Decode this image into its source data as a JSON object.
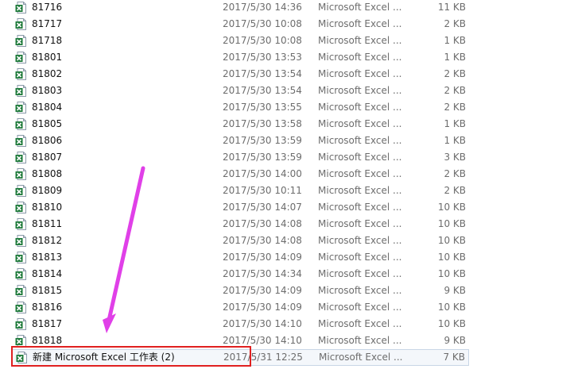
{
  "icon": "excel-file-icon",
  "colors": {
    "annotation_arrow": "#e040e8",
    "highlight_box": "#e02020",
    "excel_green": "#1d7a3a"
  },
  "files": [
    {
      "name": "81716",
      "date": "2017/5/30 14:36",
      "type": "Microsoft Excel ...",
      "size": "11 KB"
    },
    {
      "name": "81717",
      "date": "2017/5/30 10:08",
      "type": "Microsoft Excel ...",
      "size": "2 KB"
    },
    {
      "name": "81718",
      "date": "2017/5/30 10:08",
      "type": "Microsoft Excel ...",
      "size": "1 KB"
    },
    {
      "name": "81801",
      "date": "2017/5/30 13:53",
      "type": "Microsoft Excel ...",
      "size": "1 KB"
    },
    {
      "name": "81802",
      "date": "2017/5/30 13:54",
      "type": "Microsoft Excel ...",
      "size": "2 KB"
    },
    {
      "name": "81803",
      "date": "2017/5/30 13:54",
      "type": "Microsoft Excel ...",
      "size": "2 KB"
    },
    {
      "name": "81804",
      "date": "2017/5/30 13:55",
      "type": "Microsoft Excel ...",
      "size": "2 KB"
    },
    {
      "name": "81805",
      "date": "2017/5/30 13:58",
      "type": "Microsoft Excel ...",
      "size": "1 KB"
    },
    {
      "name": "81806",
      "date": "2017/5/30 13:59",
      "type": "Microsoft Excel ...",
      "size": "1 KB"
    },
    {
      "name": "81807",
      "date": "2017/5/30 13:59",
      "type": "Microsoft Excel ...",
      "size": "3 KB"
    },
    {
      "name": "81808",
      "date": "2017/5/30 14:00",
      "type": "Microsoft Excel ...",
      "size": "2 KB"
    },
    {
      "name": "81809",
      "date": "2017/5/30 10:11",
      "type": "Microsoft Excel ...",
      "size": "2 KB"
    },
    {
      "name": "81810",
      "date": "2017/5/30 14:07",
      "type": "Microsoft Excel ...",
      "size": "10 KB"
    },
    {
      "name": "81811",
      "date": "2017/5/30 14:08",
      "type": "Microsoft Excel ...",
      "size": "10 KB"
    },
    {
      "name": "81812",
      "date": "2017/5/30 14:08",
      "type": "Microsoft Excel ...",
      "size": "10 KB"
    },
    {
      "name": "81813",
      "date": "2017/5/30 14:09",
      "type": "Microsoft Excel ...",
      "size": "10 KB"
    },
    {
      "name": "81814",
      "date": "2017/5/30 14:34",
      "type": "Microsoft Excel ...",
      "size": "10 KB"
    },
    {
      "name": "81815",
      "date": "2017/5/30 14:09",
      "type": "Microsoft Excel ...",
      "size": "9 KB"
    },
    {
      "name": "81816",
      "date": "2017/5/30 14:09",
      "type": "Microsoft Excel ...",
      "size": "10 KB"
    },
    {
      "name": "81817",
      "date": "2017/5/30 14:10",
      "type": "Microsoft Excel ...",
      "size": "10 KB"
    },
    {
      "name": "81818",
      "date": "2017/5/30 14:10",
      "type": "Microsoft Excel ...",
      "size": "9 KB"
    },
    {
      "name": "新建 Microsoft Excel 工作表 (2)",
      "date": "2017/5/31 12:25",
      "type": "Microsoft Excel ...",
      "size": "7 KB"
    }
  ]
}
